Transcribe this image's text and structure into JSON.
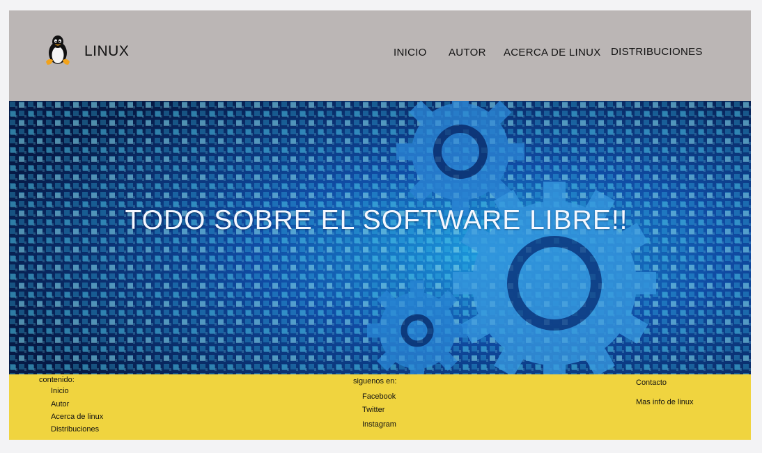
{
  "header": {
    "brand": "LINUX",
    "logo_icon": "tux-penguin-icon",
    "nav": [
      "INICIO",
      "AUTOR",
      "ACERCA DE LINUX",
      "DISTRIBUCIONES"
    ]
  },
  "hero": {
    "title": "TODO SOBRE EL SOFTWARE LIBRE!!",
    "background_icon": "binary-gears-image"
  },
  "footer": {
    "contenido": {
      "heading": "contenido:",
      "links": [
        "Inicio",
        "Autor",
        "Acerca de linux",
        "Distribuciones"
      ]
    },
    "siguenos": {
      "heading": "siguenos en:",
      "links": [
        "Facebook",
        "Twitter",
        "Instagram"
      ]
    },
    "extra": {
      "links": [
        "Contacto",
        "Mas info de linux"
      ]
    }
  },
  "colors": {
    "header_bg": "#bbb6b5",
    "footer_bg": "#f0d43f",
    "hero_bg": "#0a2a63",
    "accent_cyan": "#3fd2ff"
  }
}
